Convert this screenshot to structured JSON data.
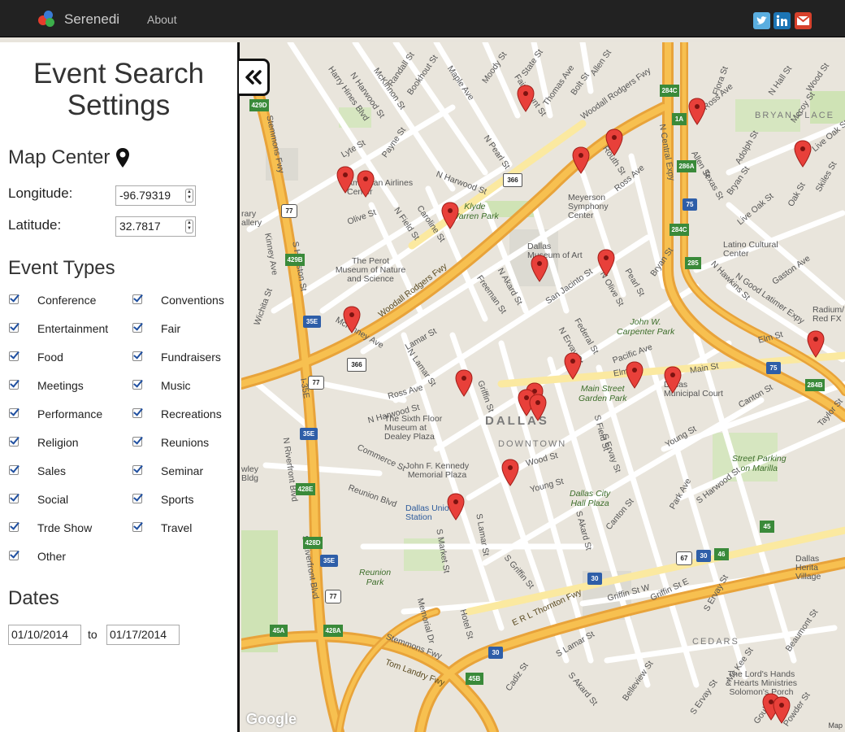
{
  "navbar": {
    "brand": "Serenedi",
    "links": [
      "About"
    ],
    "social_icons": [
      "twitter-icon",
      "linkedin-icon",
      "gmail-icon"
    ]
  },
  "sidebar": {
    "title_line1": "Event Search",
    "title_line2": "Settings",
    "map_center": {
      "heading": "Map Center",
      "icon": "map-marker-icon",
      "longitude_label": "Longitude:",
      "longitude_value": "-96.79319",
      "latitude_label": "Latitude:",
      "latitude_value": "32.7817"
    },
    "event_types": {
      "heading": "Event Types",
      "items": [
        {
          "label": "Conference",
          "checked": true
        },
        {
          "label": "Conventions",
          "checked": true
        },
        {
          "label": "Entertainment",
          "checked": true
        },
        {
          "label": "Fair",
          "checked": true
        },
        {
          "label": "Food",
          "checked": true
        },
        {
          "label": "Fundraisers",
          "checked": true
        },
        {
          "label": "Meetings",
          "checked": true
        },
        {
          "label": "Music",
          "checked": true
        },
        {
          "label": "Performance",
          "checked": true
        },
        {
          "label": "Recreations",
          "checked": true
        },
        {
          "label": "Religion",
          "checked": true
        },
        {
          "label": "Reunions",
          "checked": true
        },
        {
          "label": "Sales",
          "checked": true
        },
        {
          "label": "Seminar",
          "checked": true
        },
        {
          "label": "Social",
          "checked": true
        },
        {
          "label": "Sports",
          "checked": true
        },
        {
          "label": "Trde Show",
          "checked": true
        },
        {
          "label": "Travel",
          "checked": true
        },
        {
          "label": "Other",
          "checked": true
        }
      ]
    },
    "dates": {
      "heading": "Dates",
      "from": "01/10/2014",
      "to_label": "to",
      "to": "01/17/2014"
    },
    "collapse_icon": "double-chevron-left-icon"
  },
  "map": {
    "attribution": "Google",
    "map_data_link": "Map",
    "districts": {
      "dallas": "DALLAS",
      "downtown": "DOWNTOWN",
      "bryan_place": "BRYAN PLACE",
      "cedars": "CEDARS"
    },
    "streets": {
      "harry_hines": "Harry Hines Blvd",
      "mckinnon": "McKinnon St",
      "n_harwood_top": "N Harwood St",
      "randall": "Randall St",
      "bookhout": "Bookhout St",
      "maple": "Maple Ave",
      "moody": "Moody St",
      "fairmount": "Fairmount St",
      "state": "State St",
      "thomas": "Thomas Ave",
      "bolt": "Bolt St",
      "allen_top": "Allen St",
      "woodall_top": "Woodall Rodgers Fwy",
      "n_central": "N Central Expy",
      "flora": "Flora St",
      "ross_top": "Ross Ave",
      "hall": "N Hall St",
      "wood_top": "Wood St",
      "mccoy": "Mccoy St",
      "live_oak_right": "Live Oak St",
      "skiles": "Skiles St",
      "oak": "Oak St",
      "stemmons": "Stemmons Fwy",
      "lyte": "Lyte St",
      "payne": "Payne St",
      "olive": "Olive St",
      "n_field": "N Field St",
      "caroline": "Caroline St",
      "n_pearl": "N Pearl St",
      "routh": "Routh St",
      "n_harwood_mid": "N Harwood St",
      "ross_mid": "Ross Ave",
      "n_akard": "N Akard St",
      "san_jacinto": "San Jacinto St",
      "n_olive": "N Olive St",
      "pearl": "Pearl St",
      "bryan": "Bryan St",
      "allen_right": "Allen St",
      "texas": "Texas St",
      "adolph": "Adolph St",
      "bryan_right": "Bryan St",
      "live_oak_mid": "Live Oak St",
      "gaston": "Gaston Ave",
      "n_good_latimer": "N Good Latimer Expy",
      "n_hawkins": "N Hawkins St",
      "woodall_mid": "Woodall Rodgers Fwy",
      "n_lamar": "N Lamar St",
      "ross_low": "Ross Ave",
      "mckinney": "McKinney Ave",
      "freeman": "Freeman St",
      "n_ervay": "N Ervay St",
      "federal": "Federal St",
      "pacific": "Pacific Ave",
      "elm": "Elm St",
      "main": "Main St",
      "elm_right": "Elm St",
      "canton_right": "Canton St",
      "taylor": "Taylor St",
      "griffin": "Griffin St",
      "s_griffin": "S Griffin St",
      "commerce": "Commerce St",
      "wood_mid": "Wood St",
      "young_mid": "Young St",
      "young_right": "Young St",
      "s_harwood": "S Harwood St",
      "park": "Park Ave",
      "s_field": "S Field St",
      "s_akard": "S Akard St",
      "canton_low": "Canton St",
      "s_ervay": "S Ervay St",
      "reunion": "Reunion Blvd",
      "s_market": "S Market St",
      "s_lamar": "S Lamar St",
      "memorial": "Memorial Dr",
      "hotel": "Hotel St",
      "s_riverfront": "S Riverfront Blvd",
      "n_riverfront": "N Riverfront Blvd",
      "i35e": "I-35E",
      "stemmons_low": "Stemmons Fwy",
      "tom_landry": "Tom Landry Fwy",
      "erl_thornton": "E R L Thornton Fwy",
      "griffin_w": "Griffin St W",
      "griffin_e": "Griffin St E",
      "s_ervay_low": "S Ervay St",
      "beaumont": "Beaumont St",
      "s_lamar_low": "S Lamar St",
      "cadiz": "Cadiz St",
      "belleview": "Belleview St",
      "mckee": "Mc Kee St",
      "s_ervay_bottom": "S Ervay St",
      "s_akard_low": "S Akard St",
      "gould": "Gould St",
      "powder": "Powder St",
      "wichita": "Wichita St",
      "kinney": "Kinney Ave",
      "s_houston": "S Houston St",
      "lamar_left": "Lamar St",
      "n_harwood_low": "N Harwood St"
    },
    "places": {
      "american_airlines": "American Airlines Center",
      "perot": "The Perot\nMuseum of Nature\nand Science",
      "meyerson": "Meyerson\nSymphony\nCenter",
      "dma": "Dallas\nMuseum of Art",
      "latino": "Latino Cultural\nCenter",
      "radium": "Radium/\nRed FX",
      "sixth_floor": "The Sixth Floor\nMuseum at\nDealey Plaza",
      "jfk": "John F. Kennedy\nMemorial Plaza",
      "municipal": "Dallas\nMunicipal Court",
      "union": "Dallas Union\nStation",
      "heritage": "Dallas Herita\nVillage",
      "lords": "The Lord's Hands\n& Hearts Ministries\nSolomon's Porch",
      "gallery": "rary\nallery",
      "bldg": "wley\nBldg"
    },
    "parks": {
      "klyde": "Klyde\nWarren Park",
      "carpenter": "John W.\nCarpenter Park",
      "main_street": "Main Street\nGarden Park",
      "city_hall": "Dallas City\nHall Plaza",
      "street_parking": "Street Parking\non Marilla",
      "reunion_park": "Reunion\nPark"
    },
    "shields": {
      "s366a": "366",
      "s366b": "366",
      "s77a": "77",
      "s77b": "77",
      "s77c": "77",
      "s35e_a": "35E",
      "s35e_b": "35E",
      "s35e_c": "35E",
      "s75a": "75",
      "s75b": "75",
      "s30a": "30",
      "s30b": "30",
      "s30c": "30",
      "s67": "67",
      "e429d": "429D",
      "e429b": "429B",
      "e428e": "428E",
      "e428d": "428D",
      "e428a": "428A",
      "e45a": "45A",
      "e45b": "45B",
      "e284c": "284C",
      "e284c2": "284C",
      "e286a": "286A",
      "e285": "285",
      "e284b": "284B",
      "e46": "46",
      "e45": "45",
      "e1a": "1A"
    }
  }
}
